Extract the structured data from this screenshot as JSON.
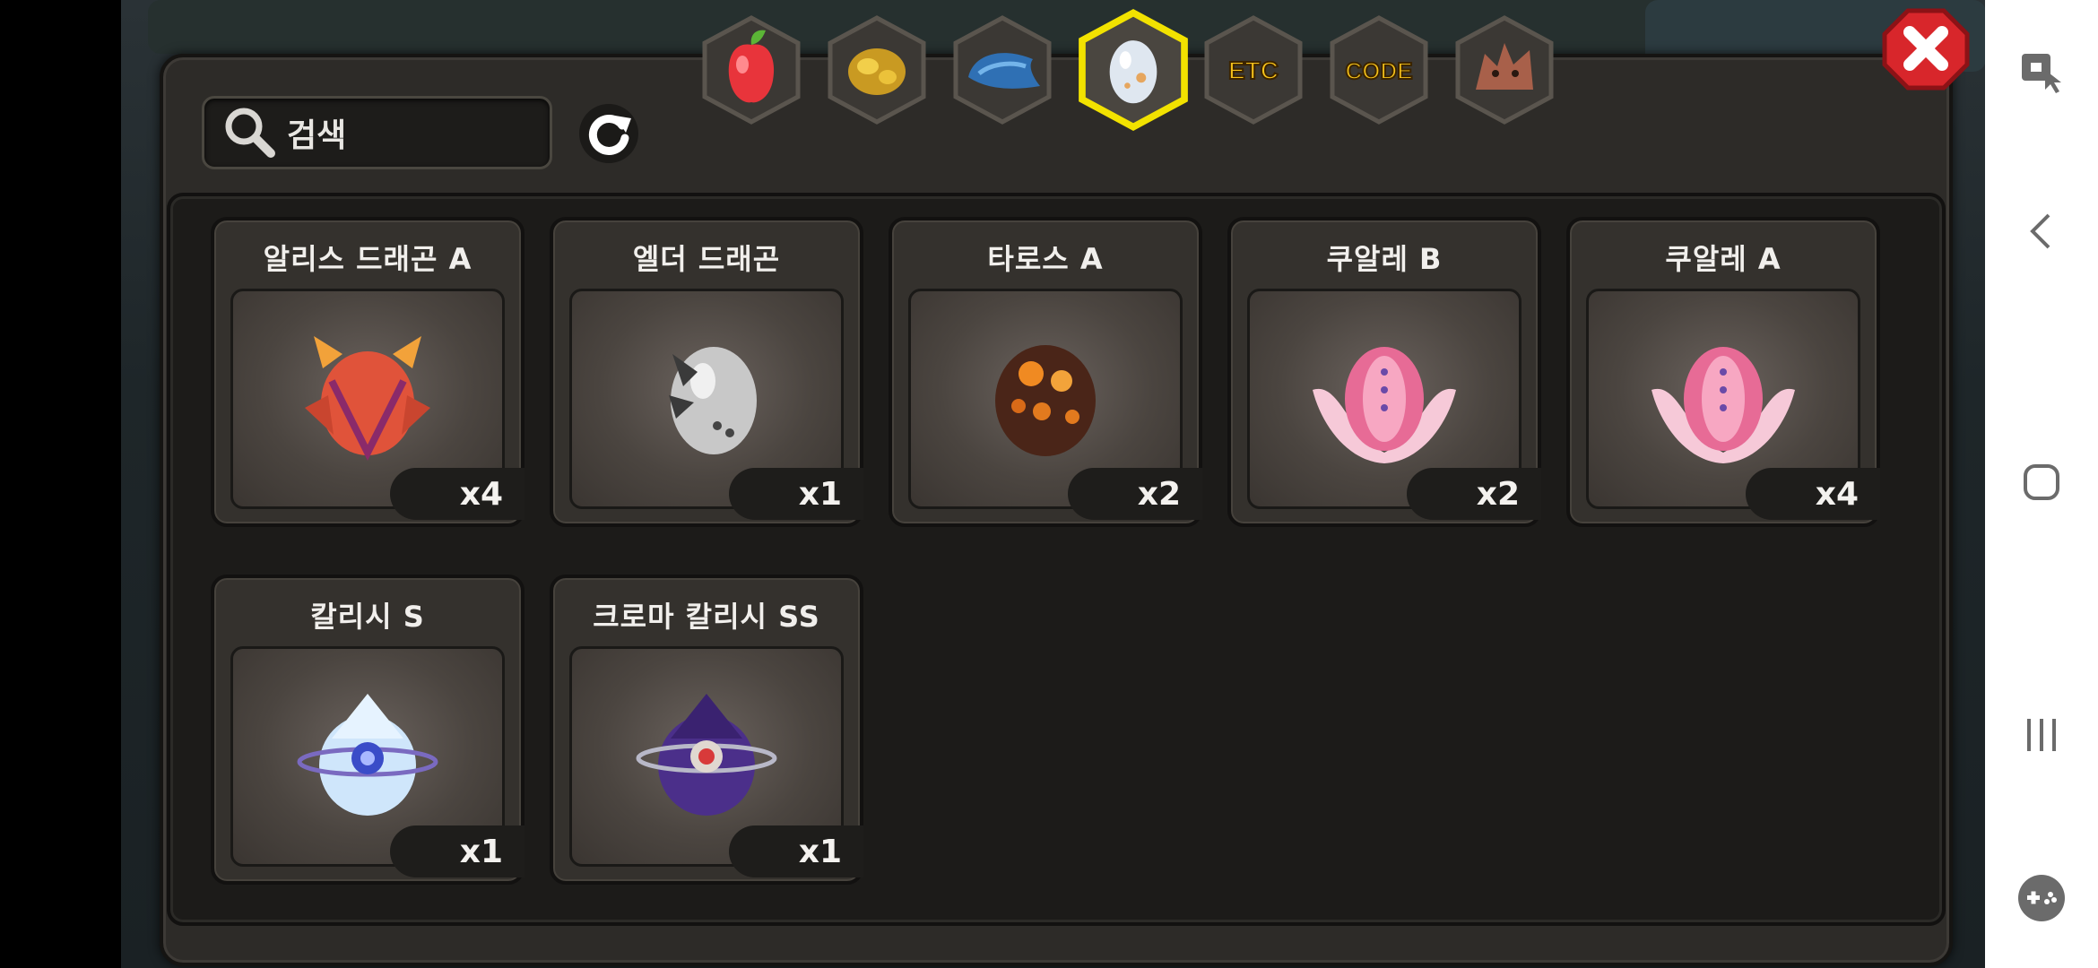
{
  "search": {
    "label": "검색"
  },
  "tabs": [
    {
      "name": "fruit",
      "icon": "red-fruit-icon",
      "label": "",
      "selected": false
    },
    {
      "name": "gold",
      "icon": "gold-ore-icon",
      "label": "",
      "selected": false
    },
    {
      "name": "scale",
      "icon": "blue-scale-icon",
      "label": "",
      "selected": false
    },
    {
      "name": "egg",
      "icon": "egg-icon",
      "label": "",
      "selected": true
    },
    {
      "name": "etc",
      "icon": "",
      "label": "ETC",
      "selected": false
    },
    {
      "name": "code",
      "icon": "",
      "label": "CODE",
      "selected": false
    },
    {
      "name": "beast",
      "icon": "dragon-head-icon",
      "label": "",
      "selected": false
    }
  ],
  "items": [
    {
      "name": "알리스 드래곤 A",
      "count": "x4",
      "icon": "orange-dragon-egg-icon"
    },
    {
      "name": "엘더 드래곤",
      "count": "x1",
      "icon": "grey-dragon-egg-icon"
    },
    {
      "name": "타로스 A",
      "count": "x2",
      "icon": "lava-egg-icon"
    },
    {
      "name": "쿠알레 B",
      "count": "x2",
      "icon": "pink-shell-egg-icon"
    },
    {
      "name": "쿠알레 A",
      "count": "x4",
      "icon": "pink-shell-egg-icon"
    },
    {
      "name": "칼리시 S",
      "count": "x1",
      "icon": "ice-crystal-egg-icon"
    },
    {
      "name": "크로마 칼리시 SS",
      "count": "x1",
      "icon": "purple-crystal-egg-icon"
    }
  ],
  "colors": {
    "selected_tab": "#f2e200",
    "panel": "#2d2b28",
    "close": "#d8262b"
  }
}
